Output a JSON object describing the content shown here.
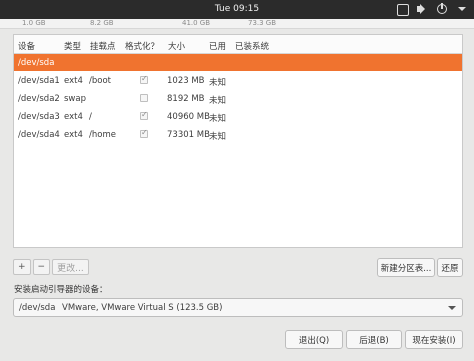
{
  "topbar": {
    "clock": "Tue 09:15"
  },
  "sizebar": {
    "labels": [
      "1.0 GB",
      "8.2 GB",
      "41.0 GB",
      "73.3 GB"
    ]
  },
  "table": {
    "columns": [
      "设备",
      "类型",
      "挂载点",
      "格式化？",
      "大小",
      "已用",
      "已装系统"
    ],
    "group": "/dev/sda",
    "rows": [
      {
        "device": "/dev/sda1",
        "type": "ext4",
        "mount": "/boot",
        "format": true,
        "size": "1023 MB",
        "used": "未知",
        "system": ""
      },
      {
        "device": "/dev/sda2",
        "type": "swap",
        "mount": "",
        "format": false,
        "size": "8192 MB",
        "used": "未知",
        "system": ""
      },
      {
        "device": "/dev/sda3",
        "type": "ext4",
        "mount": "/",
        "format": true,
        "size": "40960 MB",
        "used": "未知",
        "system": ""
      },
      {
        "device": "/dev/sda4",
        "type": "ext4",
        "mount": "/home",
        "format": true,
        "size": "73301 MB",
        "used": "未知",
        "system": ""
      }
    ]
  },
  "tools": {
    "add": "+",
    "remove": "−",
    "change": "更改..."
  },
  "buttons": {
    "new_table": "新建分区表...",
    "revert": "还原",
    "quit": "退出(Q)",
    "back": "后退(B)",
    "install_now": "现在安装(I)"
  },
  "boot": {
    "label": "安装启动引导器的设备：",
    "device": "/dev/sda",
    "description": "VMware, VMware Virtual S (123.5 GB)"
  }
}
